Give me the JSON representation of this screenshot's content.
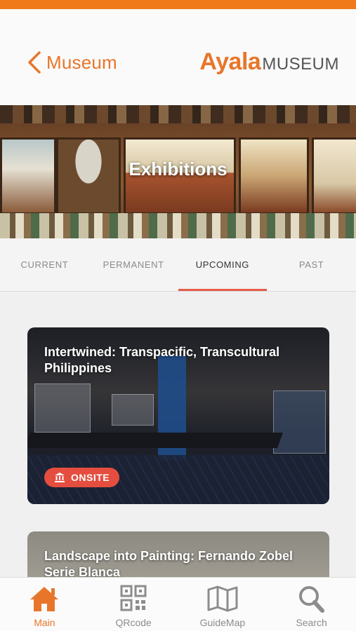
{
  "colors": {
    "accent": "#e8762a",
    "badge": "#e54d3e",
    "tab_indicator": "#e55a4a"
  },
  "header": {
    "back_label": "Museum",
    "logo": {
      "brand": "Ayala",
      "suffix": "MUSEUM"
    }
  },
  "banner": {
    "title": "Exhibitions"
  },
  "tabs": [
    {
      "label": "CURRENT",
      "active": false
    },
    {
      "label": "PERMANENT",
      "active": false
    },
    {
      "label": "UPCOMING",
      "active": true
    },
    {
      "label": "PAST",
      "active": false
    }
  ],
  "exhibitions": [
    {
      "title": "Intertwined: Transpacific, Transcultural Philippines",
      "badge": "ONSITE",
      "badge_icon": "museum-icon"
    },
    {
      "title": "Landscape into Painting: Fernando Zobel Serie Blanca"
    }
  ],
  "nav": [
    {
      "label": "Main",
      "icon": "home-icon",
      "active": true
    },
    {
      "label": "QRcode",
      "icon": "qrcode-icon",
      "active": false
    },
    {
      "label": "GuideMap",
      "icon": "map-icon",
      "active": false
    },
    {
      "label": "Search",
      "icon": "search-icon",
      "active": false
    }
  ]
}
